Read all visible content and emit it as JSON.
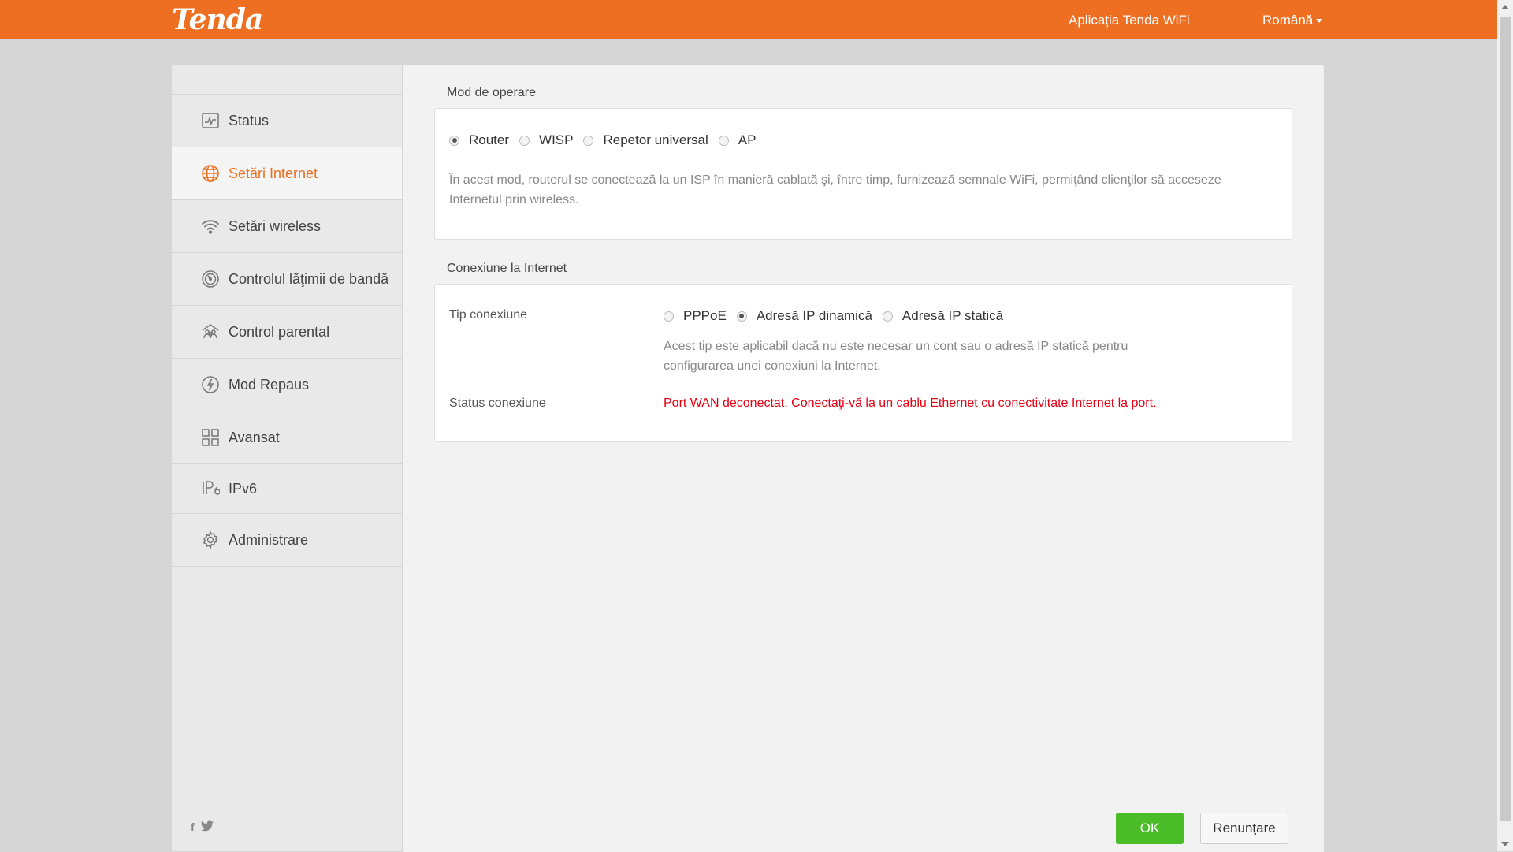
{
  "header": {
    "logo": "Tenda",
    "app_link": "Aplicația Tenda WiFi",
    "language": "Română"
  },
  "sidebar": {
    "items": [
      {
        "label": "Status",
        "icon": "status-chart-icon"
      },
      {
        "label": "Setări Internet",
        "icon": "globe-icon",
        "active": true
      },
      {
        "label": "Setări wireless",
        "icon": "wifi-icon"
      },
      {
        "label": "Controlul lăţimii de bandă",
        "icon": "speedometer-icon"
      },
      {
        "label": "Control parental",
        "icon": "family-icon"
      },
      {
        "label": "Mod Repaus",
        "icon": "power-save-icon"
      },
      {
        "label": "Avansat",
        "icon": "grid-icon"
      },
      {
        "label": "IPv6",
        "icon": "ipv6-icon"
      },
      {
        "label": "Administrare",
        "icon": "gear-icon"
      }
    ],
    "social": {
      "facebook": "f",
      "twitter": "twitter-bird"
    }
  },
  "operation_mode": {
    "title": "Mod de operare",
    "options": [
      "Router",
      "WISP",
      "Repetor universal",
      "AP"
    ],
    "selected": "Router",
    "description": "În acest mod, routerul se conectează la un ISP în manieră cablată şi, între timp, furnizează semnale WiFi, permiţând clienţilor să acceseze Internetul prin wireless."
  },
  "internet_connection": {
    "title": "Conexiune la Internet",
    "type_label": "Tip conexiune",
    "type_options": [
      "PPPoE",
      "Adresă IP dinamică",
      "Adresă IP statică"
    ],
    "type_selected": "Adresă IP dinamică",
    "type_description": "Acest tip este aplicabil dacă nu este necesar un cont sau o adresă IP statică pentru configurarea unei conexiuni la Internet.",
    "status_label": "Status conexiune",
    "status_value": "Port WAN deconectat. Conectaţi-vă la un cablu Ethernet cu conectivitate Internet la port."
  },
  "footer": {
    "ok": "OK",
    "cancel": "Renunţare"
  },
  "colors": {
    "brand": "#ee6f21",
    "ok_button": "#4bbd29",
    "error": "#e60012"
  }
}
